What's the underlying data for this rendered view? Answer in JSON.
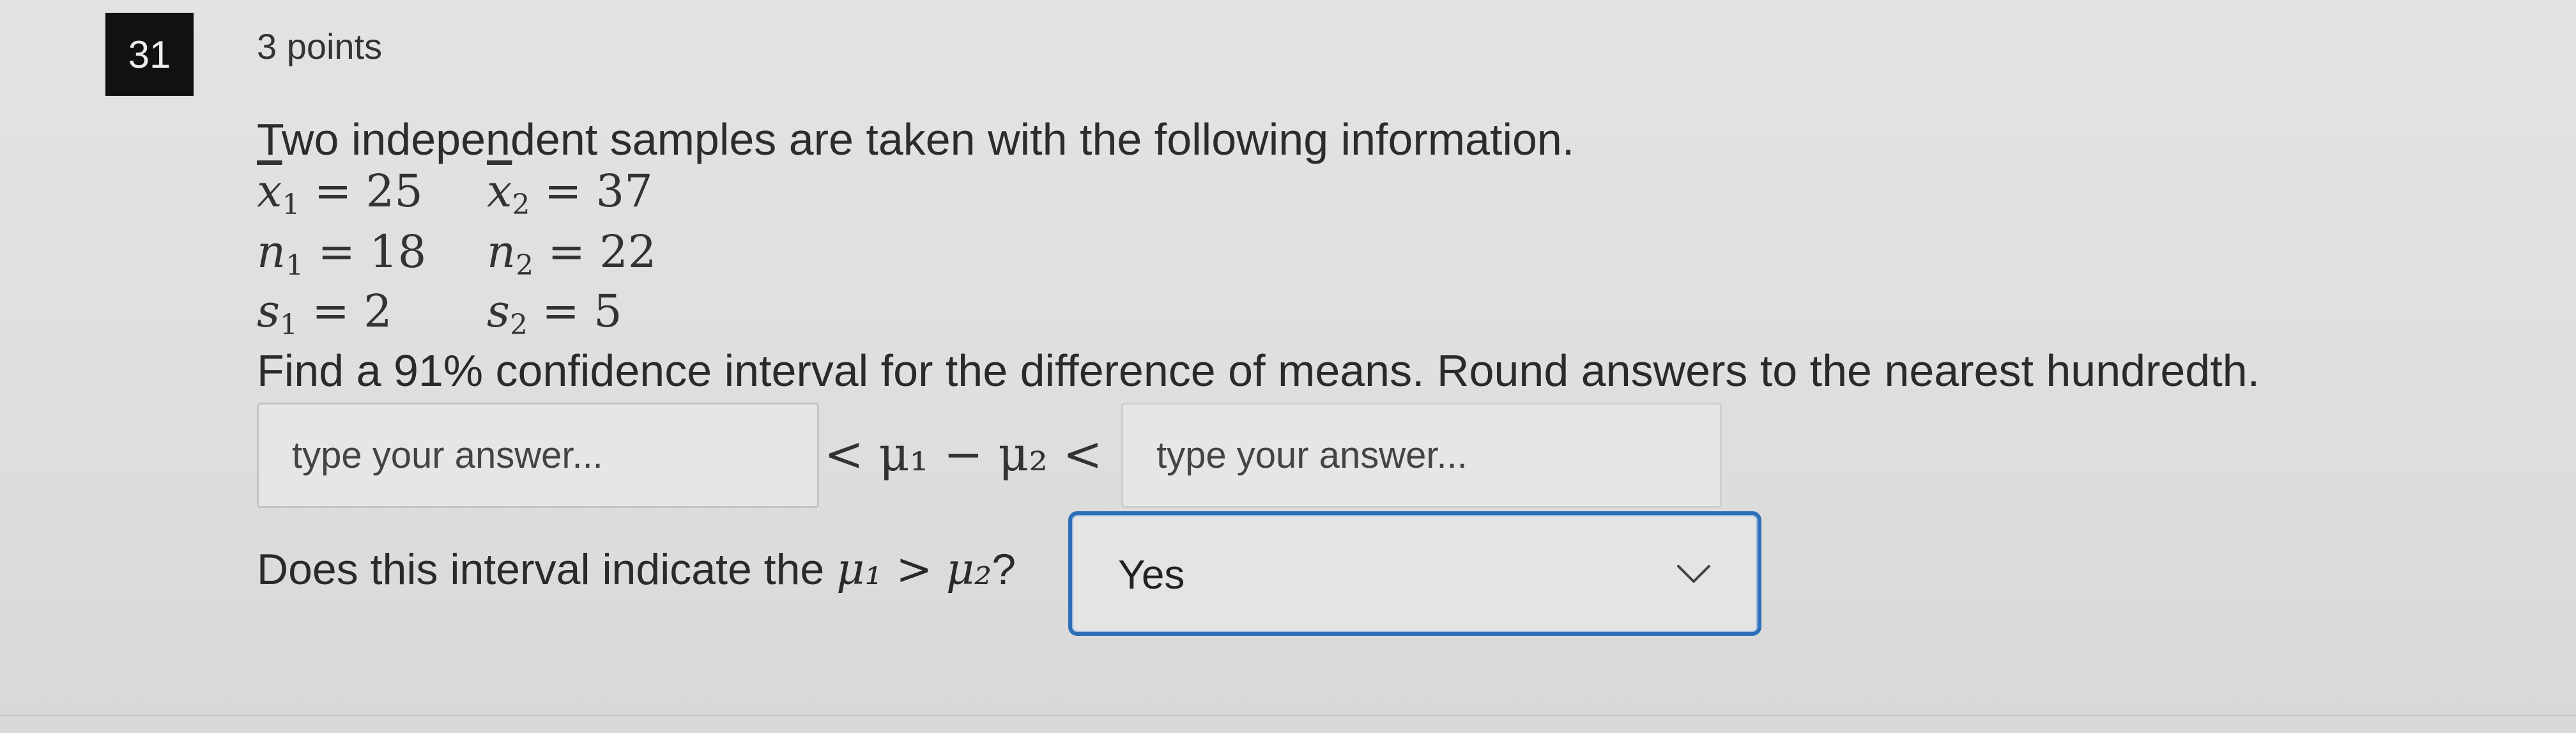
{
  "question": {
    "number": "31",
    "points": "3 points",
    "prompt": "Two independent samples are taken with the following information.",
    "stats": {
      "x1": "= 25",
      "x2": "= 37",
      "n1": "= 18",
      "n2": "= 22",
      "s1": "= 2",
      "s2": "= 5"
    },
    "instruction": "Find a 91% confidence interval for the difference of means.  Round answers to the nearest hundredth.",
    "input_lower": {
      "placeholder": "type your answer...",
      "value": ""
    },
    "input_upper": {
      "placeholder": "type your answer...",
      "value": ""
    },
    "between_text": "< μ₁ − μ₂ <",
    "followup_prefix": "Does this interval indicate the",
    "followup_math": "μ₁ > μ₂",
    "followup_suffix": "?",
    "select": {
      "selected": "Yes"
    }
  },
  "colors": {
    "badge_bg": "#111111",
    "focus_border": "#2d6fb8"
  }
}
